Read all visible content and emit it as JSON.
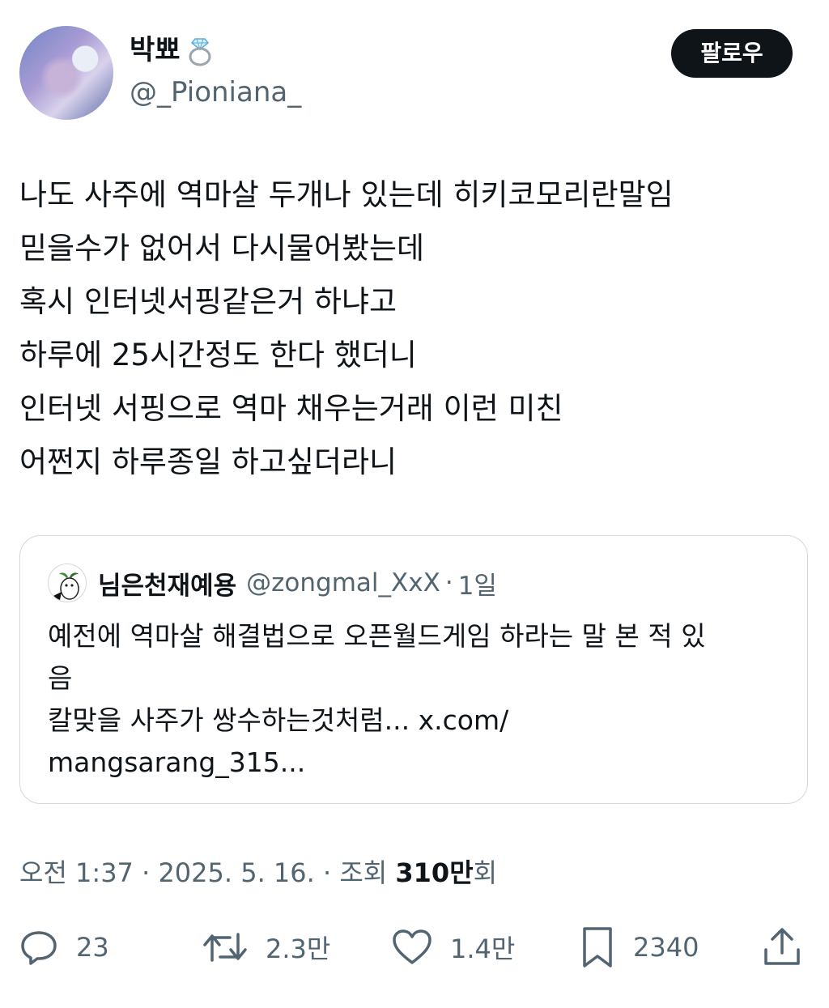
{
  "author": {
    "display_name": "박뾰",
    "emoji_icon": "ring-icon",
    "handle": "@_Pioniana_",
    "follow_label": "팔로우"
  },
  "tweet": {
    "lines": [
      "나도 사주에 역마살 두개나 있는데 히키코모리란말임",
      "믿을수가 없어서 다시물어봤는데",
      "혹시 인터넷서핑같은거 하냐고",
      "하루에 25시간정도 한다 했더니",
      "인터넷 서핑으로 역마 채우는거래 이런 미친",
      "어쩐지 하루종일 하고싶더라니"
    ]
  },
  "quote": {
    "name": "님은천재예용",
    "handle": "@zongmal_XxX",
    "separator": "·",
    "time": "1일",
    "lines": [
      "예전에 역마살 해결법으로 오픈월드게임 하라는 말 본 적 있",
      "음",
      "칼맞을 사주가 쌍수하는것처럼... x.com/",
      "mangsarang_315..."
    ]
  },
  "meta": {
    "time": "오전 1:37",
    "sep1": "·",
    "date": "2025. 5. 16.",
    "sep2": "·",
    "views_label": "조회",
    "views_count": "310만",
    "views_suffix": "회"
  },
  "actions": {
    "reply_count": "23",
    "retweet_count": "2.3만",
    "like_count": "1.4만",
    "bookmark_count": "2340"
  },
  "colors": {
    "text": "#0f1419",
    "secondary": "#536471",
    "border": "#cfd9de",
    "follow_bg": "#0f1419"
  }
}
